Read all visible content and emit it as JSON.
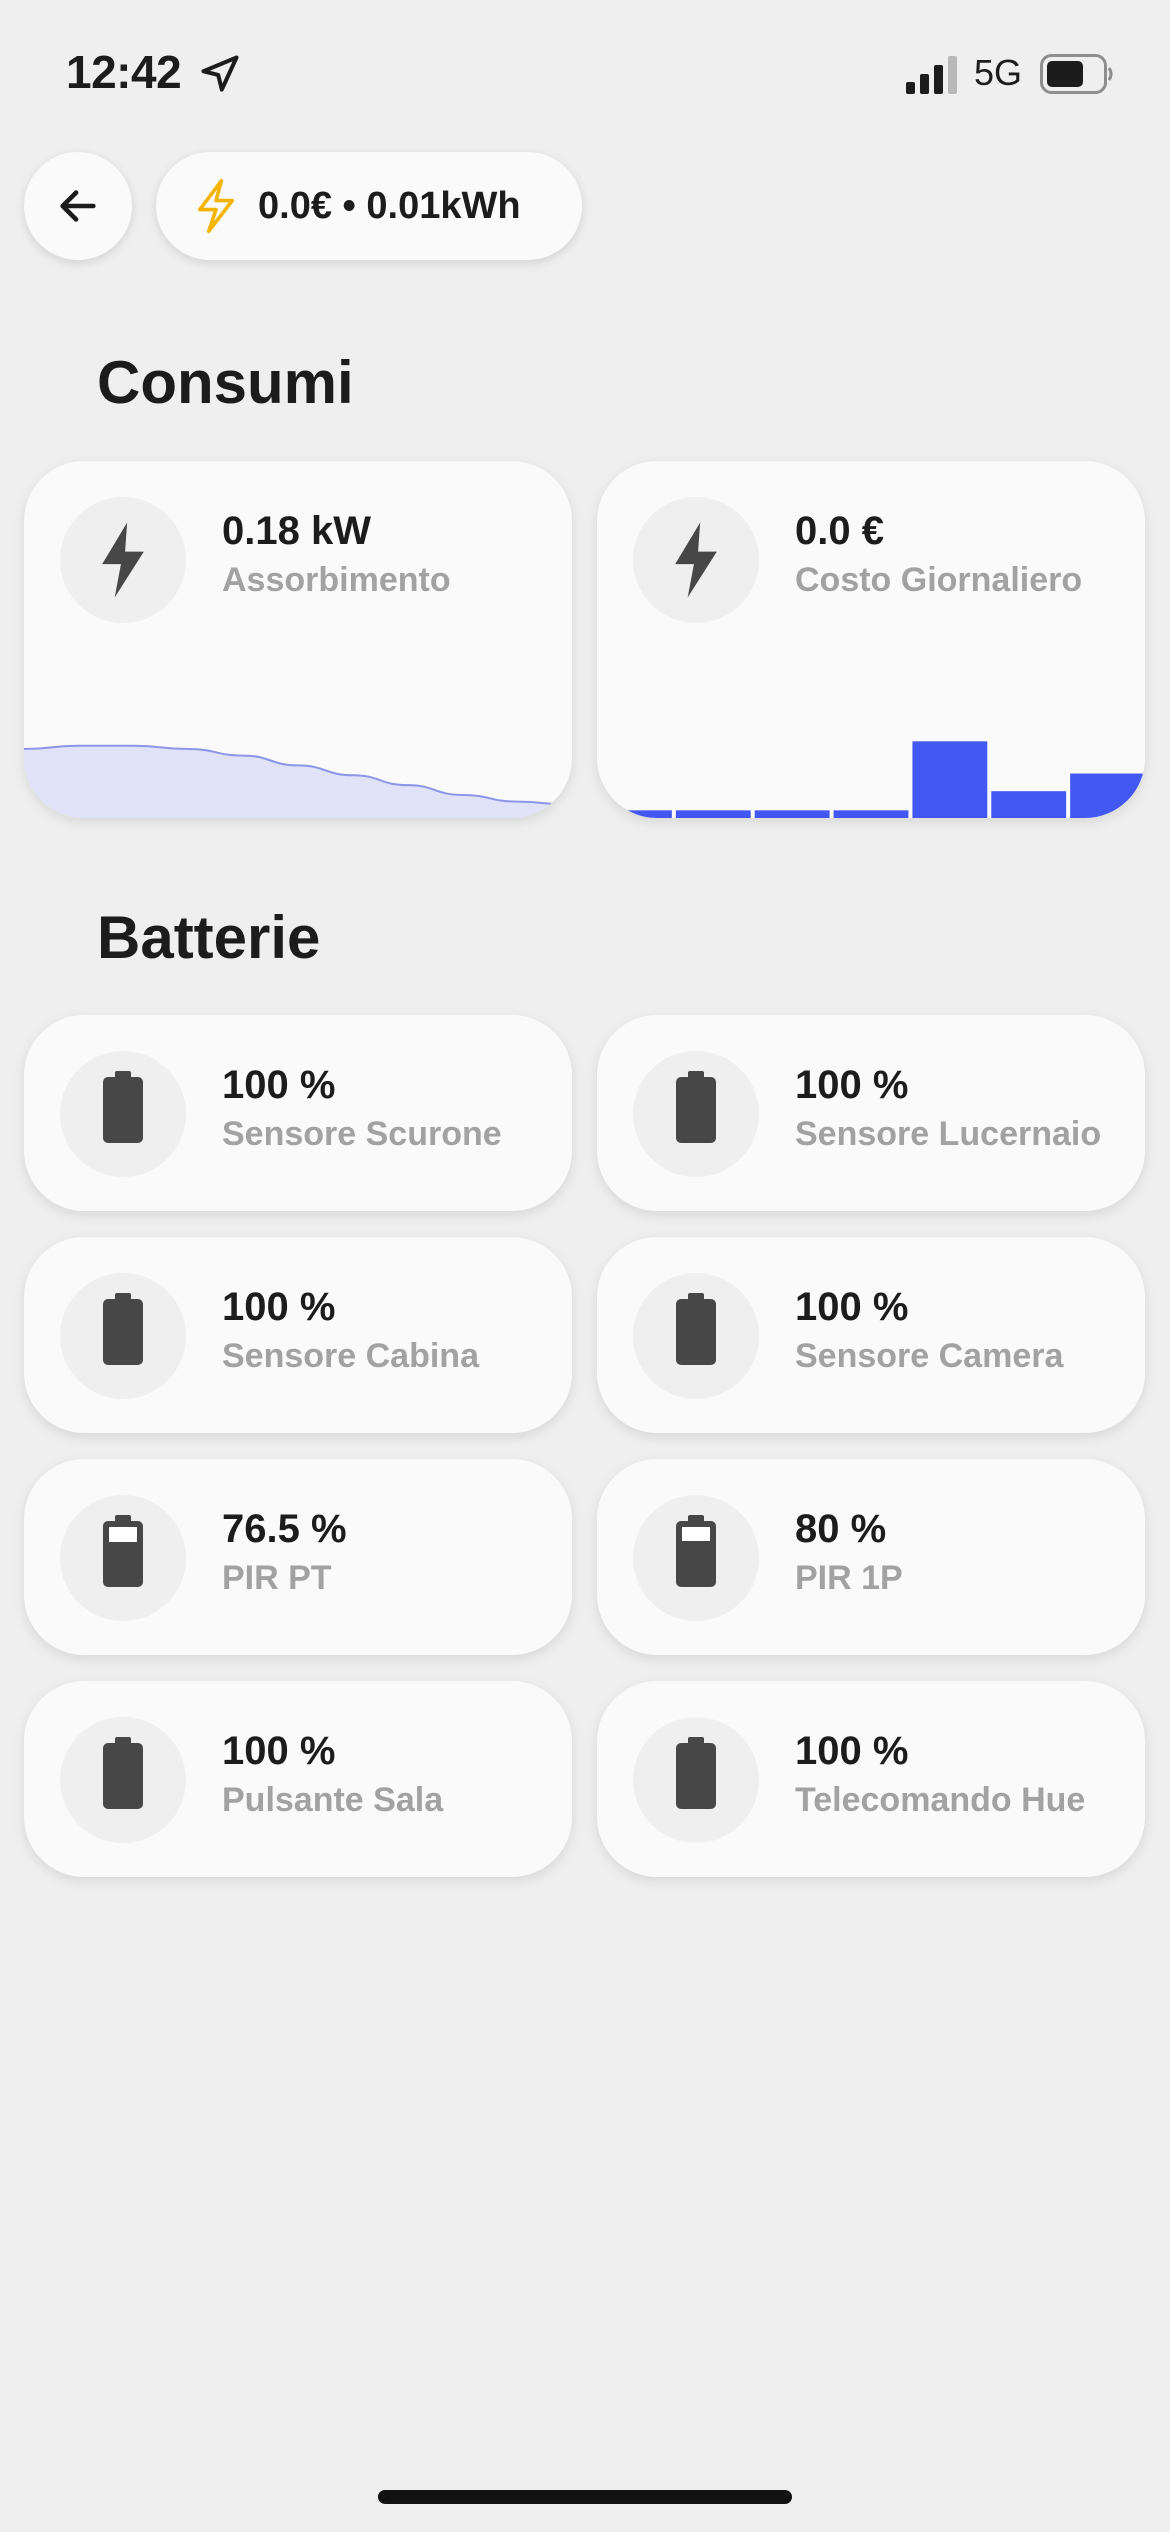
{
  "status_bar": {
    "time": "12:42",
    "network": "5G"
  },
  "header": {
    "energy_summary": "0.0€ • 0.01kWh"
  },
  "consumi": {
    "title": "Consumi",
    "cards": [
      {
        "value": "0.18 kW",
        "label": "Assorbimento"
      },
      {
        "value": "0.0 €",
        "label": "Costo Giornaliero"
      }
    ]
  },
  "chart_data": [
    {
      "type": "area",
      "title": "",
      "xlabel": "",
      "ylabel": "",
      "x": [
        0,
        1,
        2,
        3,
        4,
        5,
        6,
        7,
        8,
        9,
        10
      ],
      "values": [
        0.21,
        0.22,
        0.22,
        0.21,
        0.19,
        0.16,
        0.13,
        0.1,
        0.07,
        0.05,
        0.04
      ],
      "ylim": [
        0,
        0.35
      ],
      "grid": false,
      "color": "#8c95e8",
      "fill": "#e0e2f7"
    },
    {
      "type": "bar",
      "title": "",
      "xlabel": "",
      "ylabel": "",
      "categories": [
        "1",
        "2",
        "3",
        "4",
        "5",
        "6",
        "7"
      ],
      "values": [
        0.1,
        0.1,
        0.1,
        0.1,
        1.0,
        0.35,
        0.58
      ],
      "ylim": [
        0,
        1.5
      ],
      "grid": false,
      "color": "#4358f2"
    }
  ],
  "batterie": {
    "title": "Batterie",
    "items": [
      {
        "value": "100 %",
        "label": "Sensore Scurone",
        "level": 1.0
      },
      {
        "value": "100 %",
        "label": "Sensore Lucernaio",
        "level": 1.0
      },
      {
        "value": "100 %",
        "label": "Sensore Cabina",
        "level": 1.0
      },
      {
        "value": "100 %",
        "label": "Sensore Camera",
        "level": 1.0
      },
      {
        "value": "76.5 %",
        "label": "PIR PT",
        "level": 0.765
      },
      {
        "value": "80 %",
        "label": "PIR 1P",
        "level": 0.8
      },
      {
        "value": "100 %",
        "label": "Pulsante Sala",
        "level": 1.0
      },
      {
        "value": "100 %",
        "label": "Telecomando Hue",
        "level": 1.0
      }
    ]
  },
  "colors": {
    "accent": "#4358f2",
    "bolt_yellow": "#f4b400",
    "icon_dark": "#474747"
  }
}
